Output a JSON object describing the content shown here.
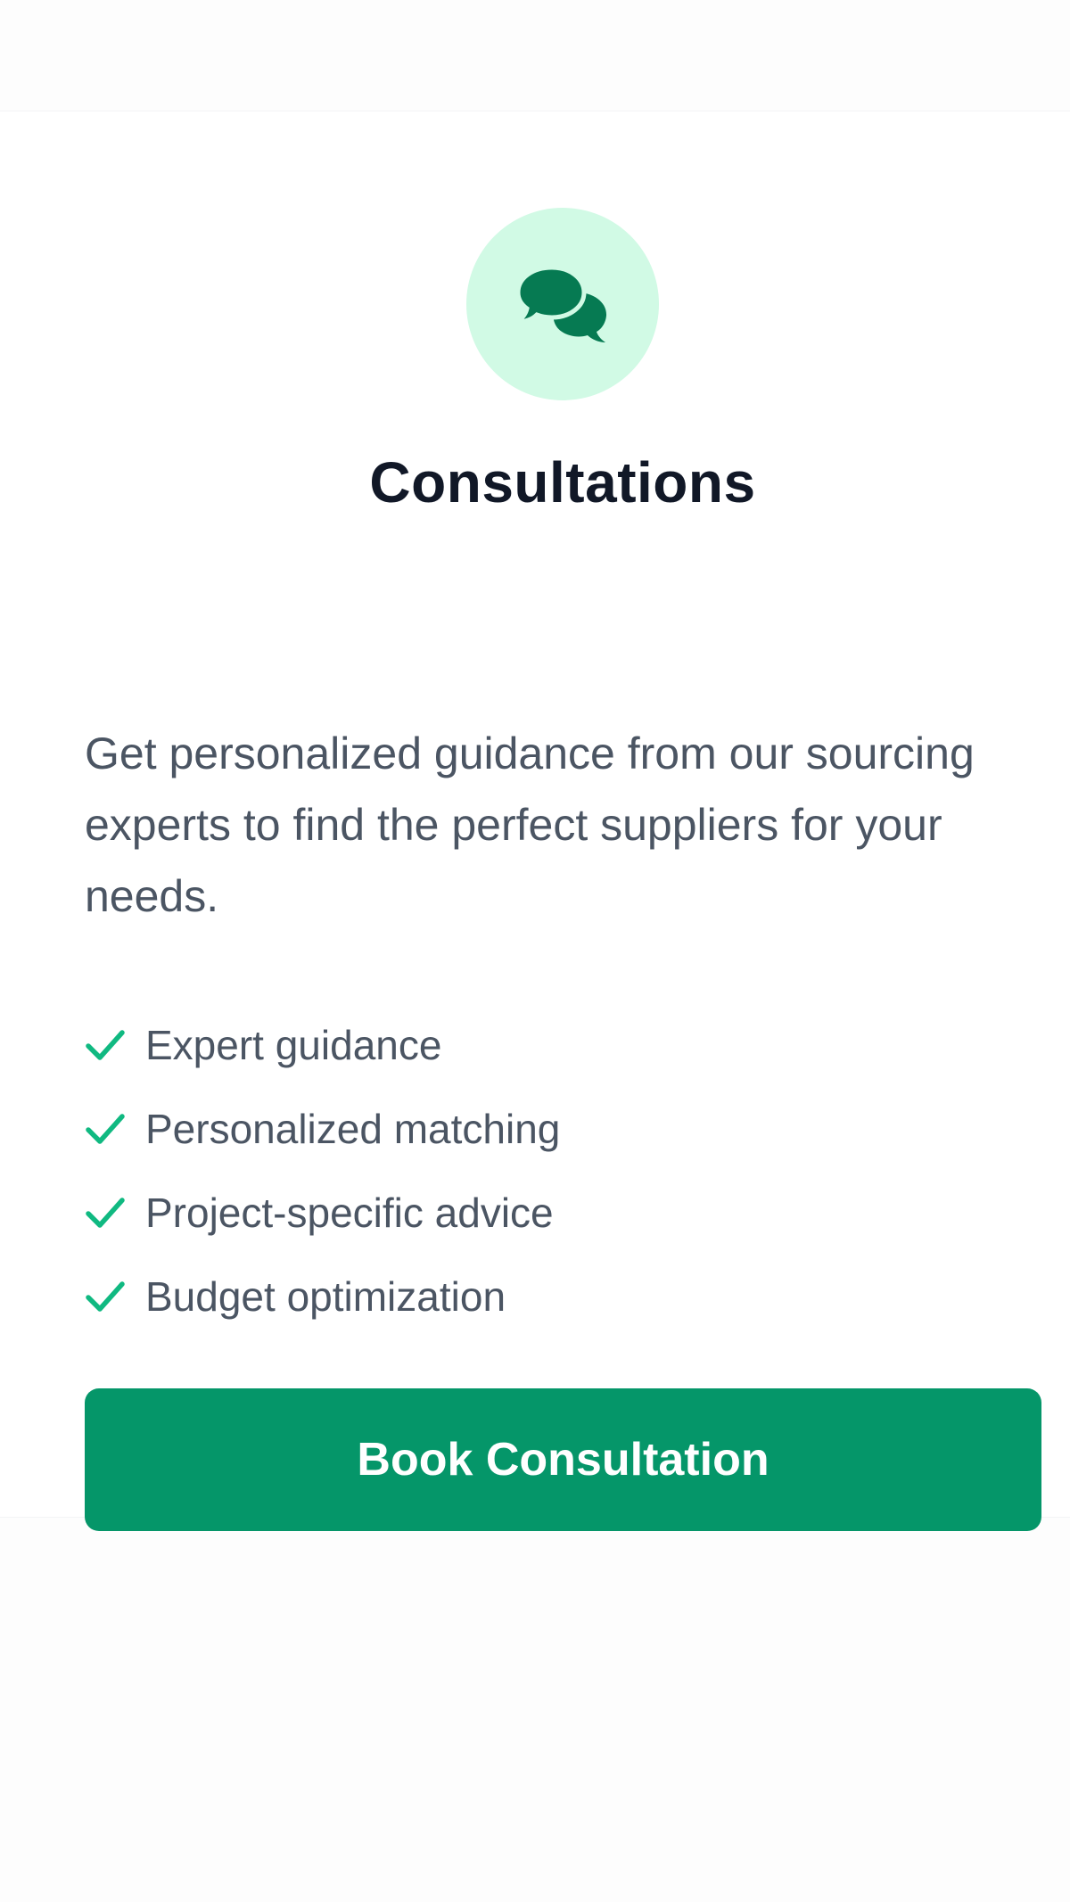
{
  "card": {
    "title": "Consultations",
    "description": "Get personalized guidance from our sourcing experts to find the perfect suppliers for your needs.",
    "icon": "comments-icon",
    "features": [
      {
        "label": "Expert guidance",
        "icon": "check-icon"
      },
      {
        "label": "Personalized matching",
        "icon": "check-icon"
      },
      {
        "label": "Project-specific advice",
        "icon": "check-icon"
      },
      {
        "label": "Budget optimization",
        "icon": "check-icon"
      }
    ],
    "button_label": "Book Consultation"
  },
  "colors": {
    "accent": "#059669",
    "icon_bg": "#d1fae5",
    "check": "#10b981",
    "title": "#111827",
    "body_text": "#4b5563"
  }
}
